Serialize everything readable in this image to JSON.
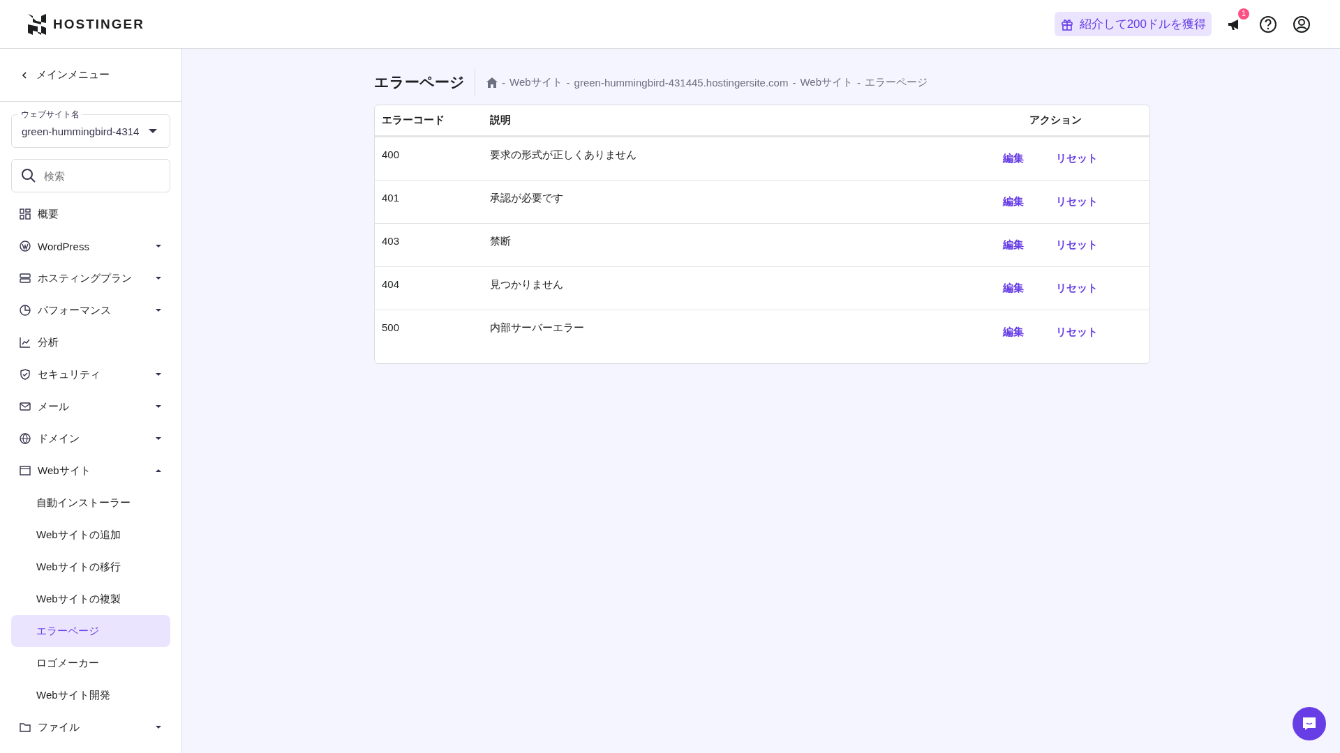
{
  "header": {
    "logo": "HOSTINGER",
    "referral": "紹介して200ドルを獲得",
    "notification_count": "1"
  },
  "sidebar": {
    "back": "メインメニュー",
    "website_select": {
      "label": "ウェブサイト名",
      "value": "green-hummingbird-4314"
    },
    "search": {
      "placeholder": "検索"
    },
    "items": [
      {
        "label": "概要"
      },
      {
        "label": "WordPress",
        "expanded": false
      },
      {
        "label": "ホスティングプラン",
        "expanded": false
      },
      {
        "label": "パフォーマンス",
        "expanded": false
      },
      {
        "label": "分析"
      },
      {
        "label": "セキュリティ",
        "expanded": false
      },
      {
        "label": "メール",
        "expanded": false
      },
      {
        "label": "ドメイン",
        "expanded": false
      },
      {
        "label": "Webサイト",
        "expanded": true,
        "children": [
          {
            "label": "自動インストーラー",
            "selected": false
          },
          {
            "label": "Webサイトの追加",
            "selected": false
          },
          {
            "label": "Webサイトの移行",
            "selected": false
          },
          {
            "label": "Webサイトの複製",
            "selected": false
          },
          {
            "label": "エラーページ",
            "selected": true
          },
          {
            "label": "ロゴメーカー",
            "selected": false
          },
          {
            "label": "Webサイト開発",
            "selected": false
          }
        ]
      },
      {
        "label": "ファイル",
        "expanded": false
      }
    ]
  },
  "page": {
    "title": "エラーページ",
    "breadcrumb_separator": "-",
    "breadcrumb": [
      "Webサイト",
      "green-hummingbird-431445.hostingersite.com",
      "Webサイト",
      "エラーページ"
    ]
  },
  "table": {
    "columns": [
      "エラーコード",
      "説明",
      "アクション"
    ],
    "rows": [
      {
        "code": "400",
        "description": "要求の形式が正しくありません",
        "actions": [
          "編集",
          "リセット"
        ]
      },
      {
        "code": "401",
        "description": "承認が必要です",
        "actions": [
          "編集",
          "リセット"
        ]
      },
      {
        "code": "403",
        "description": "禁断",
        "actions": [
          "編集",
          "リセット"
        ]
      },
      {
        "code": "404",
        "description": "見つかりません",
        "actions": [
          "編集",
          "リセット"
        ]
      },
      {
        "code": "500",
        "description": "内部サーバーエラー",
        "actions": [
          "編集",
          "リセット"
        ]
      }
    ]
  }
}
